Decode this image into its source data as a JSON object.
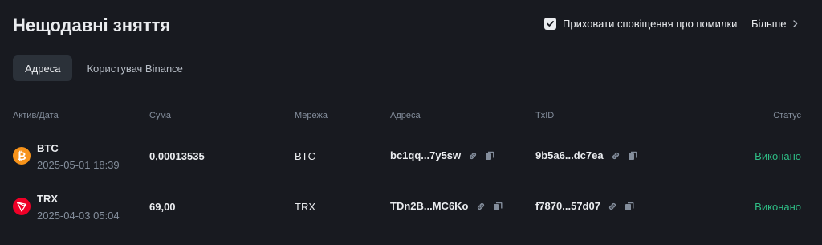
{
  "header": {
    "title": "Нещодавні зняття",
    "hide_errors_label": "Приховати сповіщення про помилки",
    "more_label": "Більше"
  },
  "tabs": [
    {
      "label": "Адреса",
      "active": true
    },
    {
      "label": "Користувач Binance",
      "active": false
    }
  ],
  "table": {
    "columns": [
      "Актив/Дата",
      "Сума",
      "Мережа",
      "Адреса",
      "TxID",
      "Статус"
    ],
    "rows": [
      {
        "asset": "BTC",
        "icon": "bitcoin-icon",
        "icon_color": "#f7931a",
        "date": "2025-05-01 18:39",
        "amount": "0,00013535",
        "network": "BTC",
        "address": "bc1qq...7y5sw",
        "txid": "9b5a6...dc7ea",
        "status": "Виконано"
      },
      {
        "asset": "TRX",
        "icon": "tron-icon",
        "icon_color": "#ef0027",
        "date": "2025-04-03 05:04",
        "amount": "69,00",
        "network": "TRX",
        "address": "TDn2B...MC6Ko",
        "txid": "f7870...57d07",
        "status": "Виконано"
      }
    ]
  },
  "colors": {
    "background": "#181a20",
    "status_success": "#2ebd85",
    "muted_text": "#848e9c",
    "tab_active_bg": "#2b3139"
  }
}
